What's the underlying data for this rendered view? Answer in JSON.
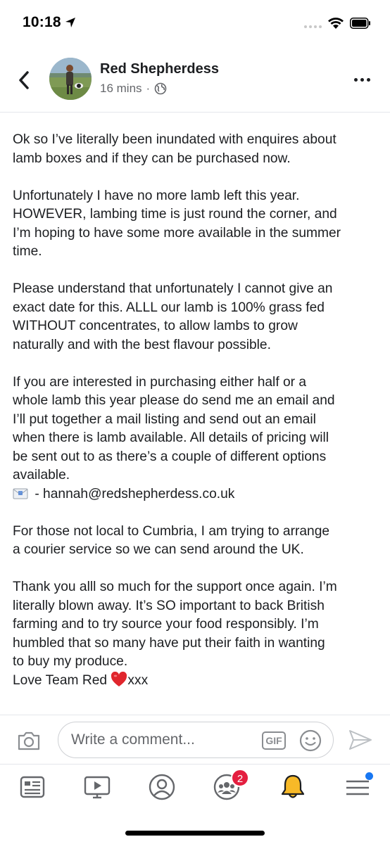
{
  "status_bar": {
    "time": "10:18",
    "icons": [
      "location-arrow-icon",
      "signal-icon",
      "wifi-icon",
      "battery-icon"
    ]
  },
  "header": {
    "back_icon": "chevron-left-icon",
    "author": "Red Shepherdess",
    "time_ago": "16 mins",
    "separator": "·",
    "privacy_icon": "globe-icon",
    "more_icon": "more-horizontal-icon"
  },
  "post": {
    "paragraphs": [
      [
        "Ok so I’ve literally been inundated with enquires about",
        "lamb boxes and if they can be purchased now."
      ],
      [
        "Unfortunately I have no more lamb left this year.",
        "HOWEVER, lambing time is just round the corner, and",
        "I’m hoping to have some more available in the summer",
        "time."
      ],
      [
        "Please understand that unfortunately I cannot give an",
        "exact date for this. ALLL our lamb is 100% grass fed",
        "WITHOUT concentrates, to allow lambs to grow",
        "naturally and with the best flavour possible."
      ],
      [
        "If you are interested in purchasing either half or a",
        "whole lamb this year please do send me an email and",
        "I’ll put together a mail listing and send out an email",
        "when there is lamb available. All details of pricing will",
        "be sent out to as there’s a couple of different options",
        "available."
      ]
    ],
    "email_line": " - hannah@redshepherdess.co.uk",
    "paragraphs_2": [
      [
        "For those not local to Cumbria, I am trying to arrange",
        "a courier service so we can send around the UK."
      ],
      [
        "Thank you alll so much for the support once again. I’m",
        "literally blown away. It’s SO important to back British",
        "farming and to try source your food responsibly. I’m",
        "humbled that so many have put their faith in wanting",
        "to buy my produce."
      ]
    ],
    "signoff_text": "Love Team Red ",
    "signoff_end": "xxx"
  },
  "comment_bar": {
    "placeholder": "Write a comment...",
    "gif_label": "GIF"
  },
  "tab_bar": {
    "tabs": [
      "news-feed-icon",
      "watch-icon",
      "profile-icon",
      "groups-icon",
      "notifications-icon",
      "menu-icon"
    ],
    "groups_badge": "2"
  },
  "colors": {
    "text": "#1c1e21",
    "secondary": "#65676b",
    "badge": "#e41e3f",
    "accent": "#1877f2",
    "bell": "#f7b928"
  }
}
